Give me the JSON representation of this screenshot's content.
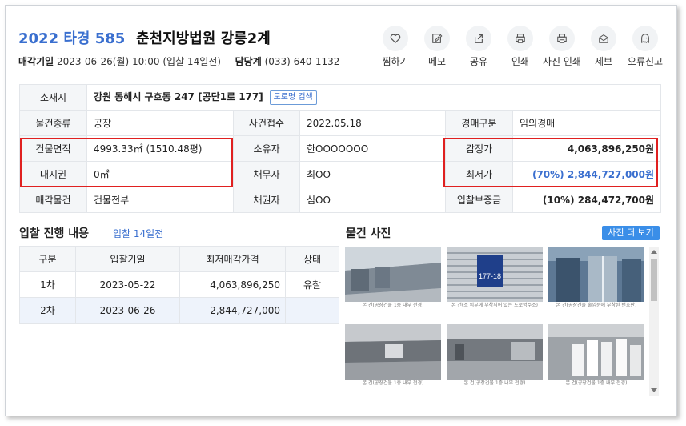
{
  "header": {
    "case_no": "2022 타경 585",
    "court": "춘천지방법원 강릉2계",
    "sale_date_label": "매각기일",
    "sale_date_value": "2023-06-26(월) 10:00 (입찰 14일전)",
    "dept_label": "담당계",
    "dept_value": "(033) 640-1132"
  },
  "actions": [
    {
      "label": "찜하기",
      "icon": "heart-icon"
    },
    {
      "label": "메모",
      "icon": "pencil-icon"
    },
    {
      "label": "공유",
      "icon": "share-icon"
    },
    {
      "label": "인쇄",
      "icon": "printer-icon"
    },
    {
      "label": "사진 인쇄",
      "icon": "printer-icon"
    },
    {
      "label": "제보",
      "icon": "mail-icon"
    },
    {
      "label": "오류신고",
      "icon": "ghost-icon"
    }
  ],
  "info": {
    "location_label": "소재지",
    "location_value": "강원 동해시 구호동 247 [공단1로 177]",
    "road_search": "도로명 검색",
    "type_label": "물건종류",
    "type_value": "공장",
    "received_label": "사건접수",
    "received_value": "2022.05.18",
    "auction_type_label": "경매구분",
    "auction_type_value": "임의경매",
    "building_area_label": "건물면적",
    "building_area_value": "4993.33㎡ (1510.48평)",
    "owner_label": "소유자",
    "owner_value": "한OOOOOOO",
    "appraisal_label": "감정가",
    "appraisal_value": "4,063,896,250원",
    "land_right_label": "대지권",
    "land_right_value": "0㎡",
    "debtor_label": "채무자",
    "debtor_value": "최OO",
    "min_price_label": "최저가",
    "min_price_value": "(70%) 2,844,727,000원",
    "sale_item_label": "매각물건",
    "sale_item_value": "건물전부",
    "creditor_label": "채권자",
    "creditor_value": "심OO",
    "deposit_label": "입찰보증금",
    "deposit_value": "(10%) 284,472,700원"
  },
  "progress": {
    "title": "입찰 진행 내용",
    "subtitle": "입찰 14일전",
    "headers": [
      "구분",
      "입찰기일",
      "최저매각가격",
      "상태"
    ],
    "rows": [
      [
        "1차",
        "2023-05-22",
        "4,063,896,250",
        "유찰"
      ],
      [
        "2차",
        "2023-06-26",
        "2,844,727,000",
        ""
      ]
    ]
  },
  "photos": {
    "title": "물건 사진",
    "more_button": "사진 더 보기",
    "captions": [
      "본 건(공장건물 1층 내부 전경)",
      "본 건(소 외부에 부착되어 있는 도로명주소)",
      "본 건(공장건물 출입문에 부착된 번호판)",
      "본 건(공장건물 1층 내부 전경)",
      "본 건(공장건물 1층 내부 전경)",
      "본 건(공장건물 1층 내부 전경)"
    ],
    "plate_text": "177-18"
  },
  "colors": {
    "accent": "#3a6fcf",
    "highlight_box": "#e02020",
    "button_blue": "#3a8ee8"
  }
}
